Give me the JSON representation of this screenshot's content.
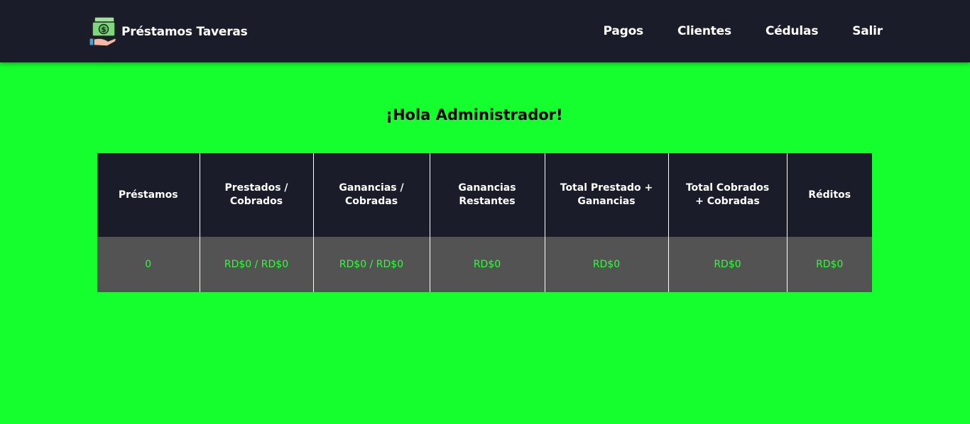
{
  "navbar": {
    "brand_name": "Préstamos Taveras",
    "logo_icon": "money-hand-icon",
    "links": [
      {
        "label": "Pagos"
      },
      {
        "label": "Clientes"
      },
      {
        "label": "Cédulas"
      },
      {
        "label": "Salir"
      }
    ]
  },
  "main": {
    "greeting": "¡Hola Administrador!",
    "table": {
      "headers": [
        "Préstamos",
        "Prestados / Cobrados",
        "Ganancias / Cobradas",
        "Ganancias Restantes",
        "Total Prestado + Ganancias",
        "Total Cobrados + Cobradas",
        "Réditos"
      ],
      "row": [
        "0",
        "RD$0 / RD$0",
        "RD$0 / RD$0",
        "RD$0",
        "RD$0",
        "RD$0",
        "RD$0"
      ]
    }
  },
  "colors": {
    "background": "#15ff2e",
    "navbar": "#1a1d29",
    "table_header": "#1a1d29",
    "table_row": "#535353",
    "table_value": "#2bff36"
  }
}
